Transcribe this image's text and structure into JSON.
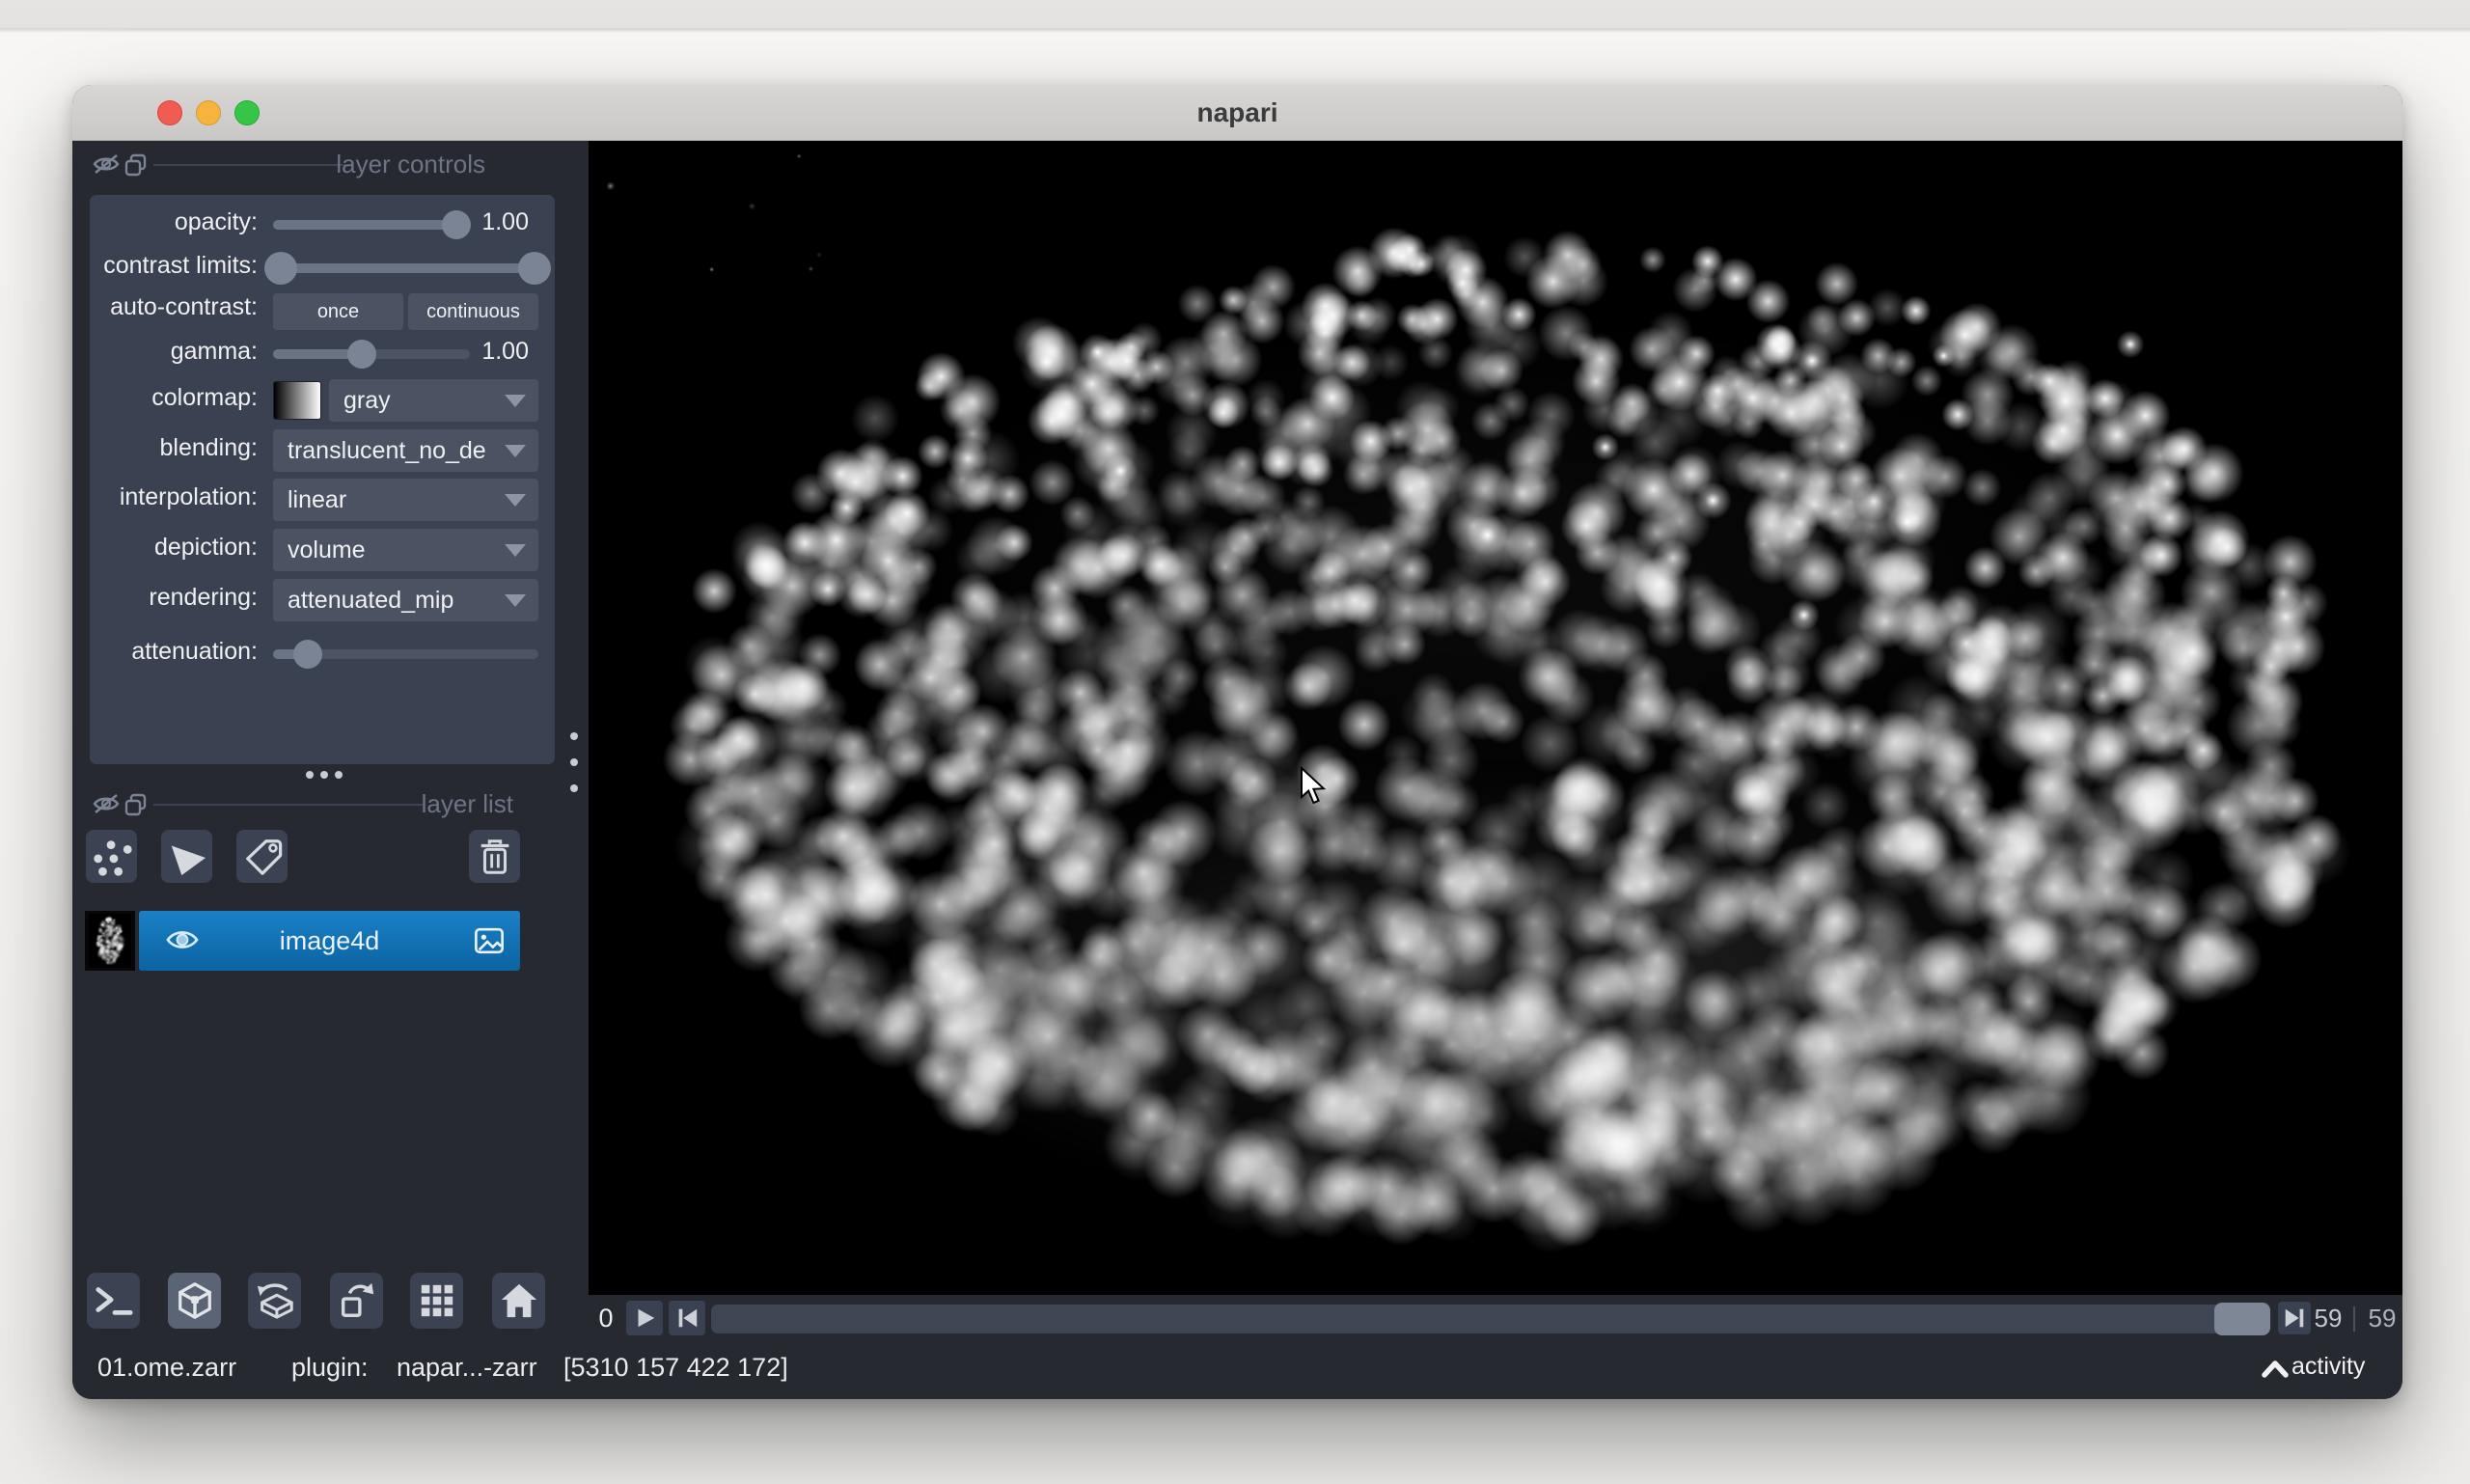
{
  "window": {
    "title": "napari"
  },
  "traffic_lights": {
    "close": "close-button",
    "minimize": "minimize-button",
    "zoom": "zoom-button"
  },
  "layer_controls": {
    "panel_title": "layer controls",
    "opacity": {
      "label": "opacity:",
      "value": "1.00",
      "fraction": 0.93
    },
    "contrast_limits": {
      "label": "contrast limits:",
      "low": 0.03,
      "high": 0.985
    },
    "auto_contrast": {
      "label": "auto-contrast:",
      "buttons": [
        "once",
        "continuous"
      ]
    },
    "gamma": {
      "label": "gamma:",
      "value": "1.00",
      "fraction": 0.45
    },
    "colormap": {
      "label": "colormap:",
      "value": "gray"
    },
    "blending": {
      "label": "blending:",
      "value": "translucent_no_de"
    },
    "interpolation": {
      "label": "interpolation:",
      "value": "linear"
    },
    "depiction": {
      "label": "depiction:",
      "value": "volume"
    },
    "rendering": {
      "label": "rendering:",
      "value": "attenuated_mip"
    },
    "attenuation": {
      "label": "attenuation:",
      "fraction": 0.13
    }
  },
  "layer_list": {
    "panel_title": "layer list",
    "buttons": [
      "new-points-layer",
      "new-shapes-layer",
      "new-labels-layer",
      "delete-layer"
    ],
    "layers": [
      {
        "name": "image4d",
        "visible": true,
        "selected": true,
        "type": "image"
      }
    ]
  },
  "viewer_buttons": [
    "console",
    "toggle-ndisplay",
    "roll-dimensions",
    "transpose-dimensions",
    "grid-view",
    "home"
  ],
  "dims": {
    "axis_label": "0",
    "current": "59",
    "total": "59",
    "slider_fraction": 1.0
  },
  "status_bar": {
    "layer_name": "01.ome.zarr",
    "plugin_label": "plugin:",
    "plugin_value": "napar...-zarr",
    "coordinates": "[5310 157 422 172]",
    "activity_label": "activity"
  },
  "colors": {
    "background": "#262930",
    "foreground": "#3a4150",
    "control": "#4b5363",
    "track": "#4c5464",
    "handle": "#7b8494",
    "text": "#f0f1f2",
    "muted": "#6d7585",
    "icon": "#d2d6da",
    "selection_top": "#1a80c6",
    "selection_bottom": "#0c63a2",
    "canvas": "#000000",
    "titlebar": "#cccbca"
  },
  "viewer_canvas": {
    "description": "3D attenuated-MIP volume rendering of an embryo with fluorescently labeled nuclei",
    "background": "#000000",
    "embryo": {
      "seed": 12,
      "cx": 0.509,
      "cy": 0.513,
      "rx": 0.474,
      "ry": 0.437,
      "nuclei": 1400,
      "bright_spots": 11
    }
  }
}
